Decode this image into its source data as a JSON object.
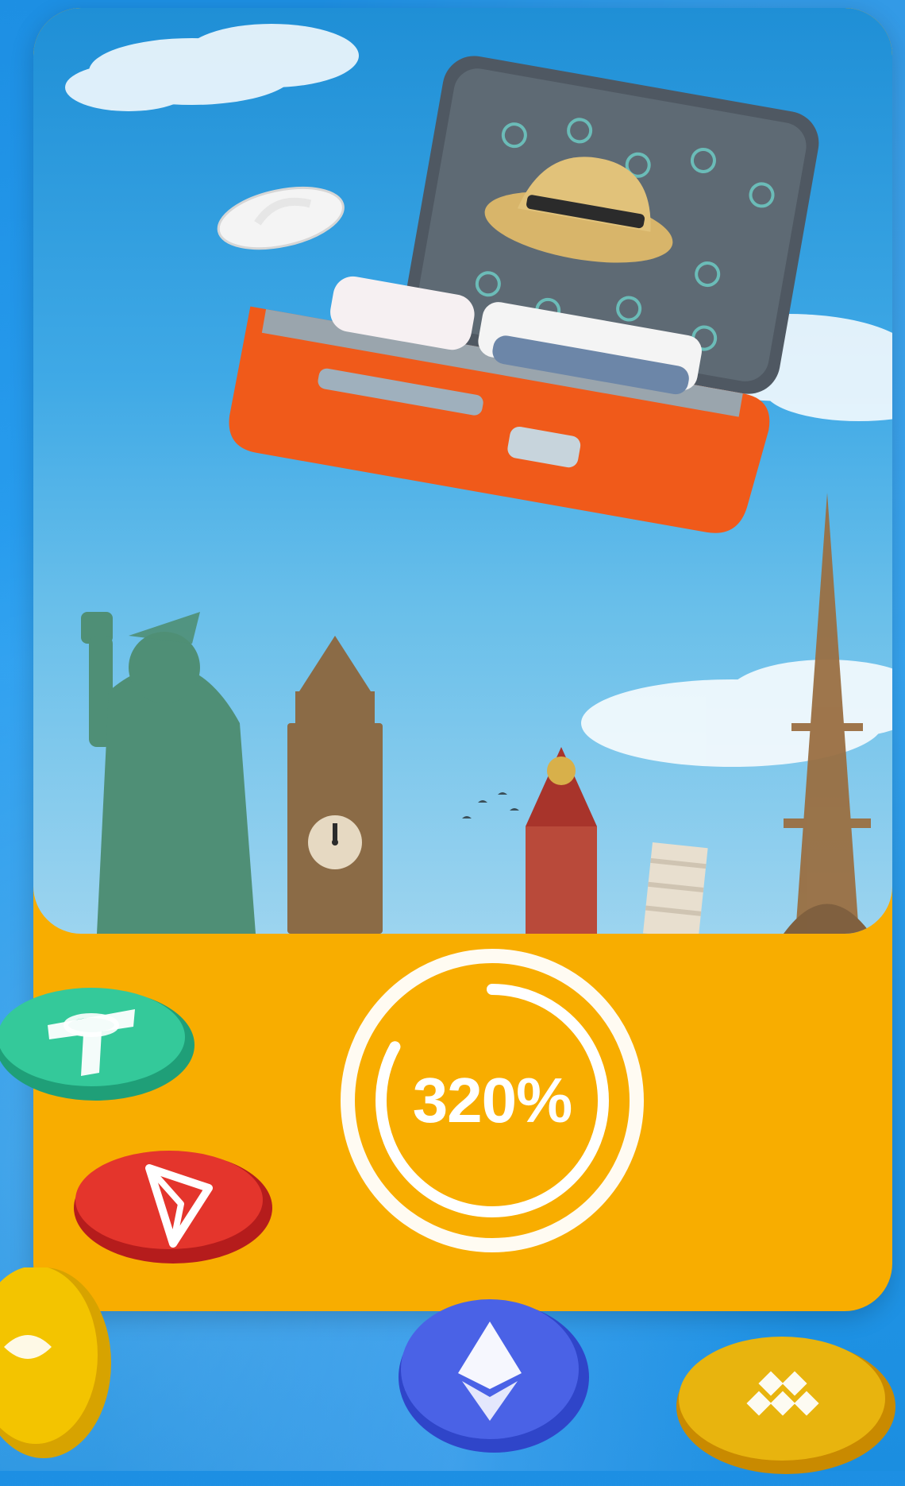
{
  "promo": {
    "percentage": "320%",
    "progress_fraction": 0.83
  },
  "colors": {
    "background": "#1d8fe3",
    "card": "#f8ad00",
    "ring": "#ffffff",
    "sky_top": "#1f8fd6",
    "sky_bottom": "#9cd4ef",
    "suitcase": "#f05a1a"
  },
  "coins": [
    {
      "name": "tether-coin",
      "color": "#34c99a"
    },
    {
      "name": "tron-coin",
      "color": "#e4352c"
    },
    {
      "name": "bitcoin-coin",
      "color": "#f3c400"
    },
    {
      "name": "ethereum-coin",
      "color": "#4a62e6"
    },
    {
      "name": "binance-coin",
      "color": "#e8b40e"
    }
  ]
}
